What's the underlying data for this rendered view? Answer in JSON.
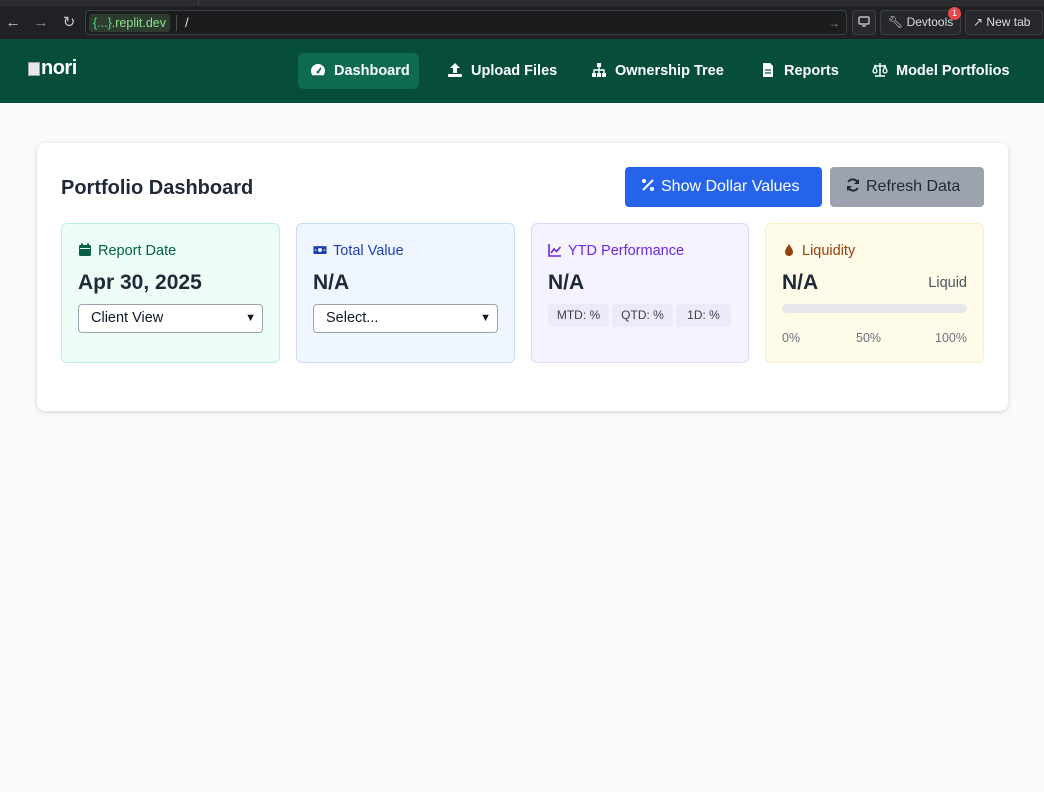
{
  "browser": {
    "url_host_braces": "{...}",
    "url_host_domain": ".replit.dev",
    "url_path": "/",
    "devtools_label": "Devtools",
    "devtools_badge": "1",
    "newtab_label": "New tab"
  },
  "app": {
    "logo_text": "nori",
    "nav": [
      {
        "label": "Dashboard",
        "icon": "gauge-icon",
        "active": true
      },
      {
        "label": "Upload Files",
        "icon": "upload-icon",
        "active": false
      },
      {
        "label": "Ownership Tree",
        "icon": "sitemap-icon",
        "active": false
      },
      {
        "label": "Reports",
        "icon": "file-icon",
        "active": false
      },
      {
        "label": "Model Portfolios",
        "icon": "balance-scale-icon",
        "active": false
      }
    ]
  },
  "dashboard": {
    "title": "Portfolio Dashboard",
    "show_dollar_label": "Show Dollar Values",
    "refresh_label": "Refresh Data",
    "report_date": {
      "label": "Report Date",
      "value": "Apr 30, 2025",
      "view_select": "Client View",
      "icon": "calendar-icon"
    },
    "total_value": {
      "label": "Total Value",
      "value": "N/A",
      "select": "Select...",
      "icon": "money-bill-icon"
    },
    "ytd": {
      "label": "YTD Performance",
      "value": "N/A",
      "mtd": "MTD: %",
      "qtd": "QTD: %",
      "one_d": "1D: %",
      "icon": "line-chart-icon"
    },
    "liquidity": {
      "label": "Liquidity",
      "value": "N/A",
      "tag": "Liquid",
      "level": 0,
      "scale": [
        "0%",
        "50%",
        "100%"
      ],
      "icon": "droplet-icon"
    }
  },
  "colors": {
    "header_bg": "#064e3b",
    "primary": "#2563eb",
    "secondary": "#9ca3af"
  }
}
